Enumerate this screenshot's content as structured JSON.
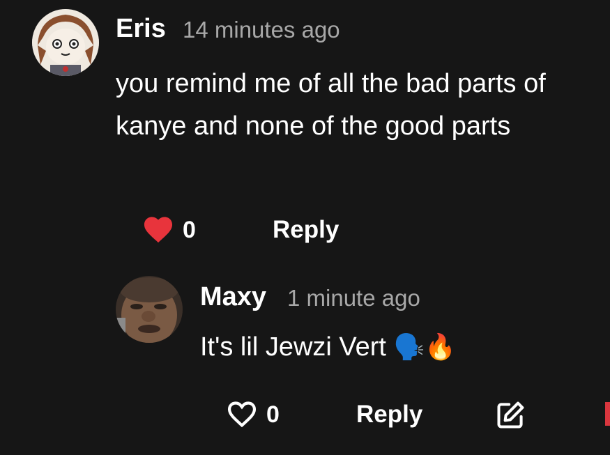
{
  "comment": {
    "author": "Eris",
    "timestamp": "14 minutes ago",
    "text": "you remind me of all the bad parts of kanye and none of the good parts",
    "like_count": "0",
    "reply_label": "Reply",
    "liked": true,
    "like_color": "#e8343c"
  },
  "reply": {
    "author": "Maxy",
    "timestamp": "1 minute ago",
    "text": "It's lil Jewzi Vert",
    "emojis": "🗣️🔥",
    "like_count": "0",
    "reply_label": "Reply",
    "liked": false
  },
  "icons": {
    "like_filled": "heart-icon",
    "like_outline": "heart-outline-icon",
    "edit": "edit-icon"
  }
}
